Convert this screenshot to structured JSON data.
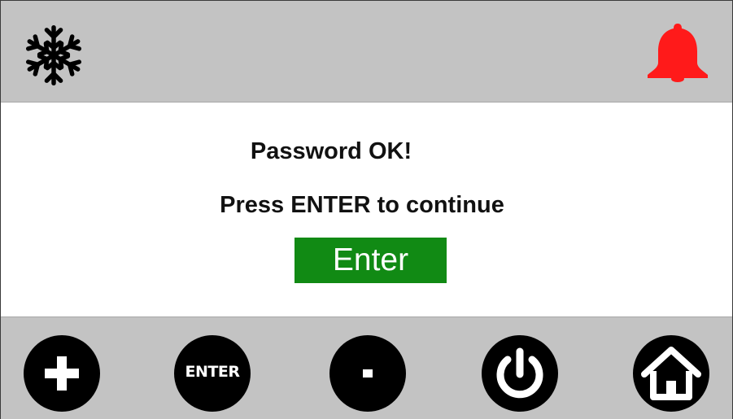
{
  "header": {
    "left_icon": "snowflake-icon",
    "right_icon": "bell-icon",
    "alarm_color": "#ff1a1a"
  },
  "message": {
    "title": "Password OK!",
    "subtitle": "Press ENTER to continue"
  },
  "enter_button": {
    "label": "Enter",
    "color": "#118a14"
  },
  "footer": {
    "buttons": [
      {
        "name": "plus-button",
        "icon": "plus-icon"
      },
      {
        "name": "enter-round-button",
        "label": "ENTER"
      },
      {
        "name": "minus-button",
        "icon": "minus-icon"
      },
      {
        "name": "power-button",
        "icon": "power-icon"
      },
      {
        "name": "home-button",
        "icon": "home-icon"
      }
    ]
  }
}
